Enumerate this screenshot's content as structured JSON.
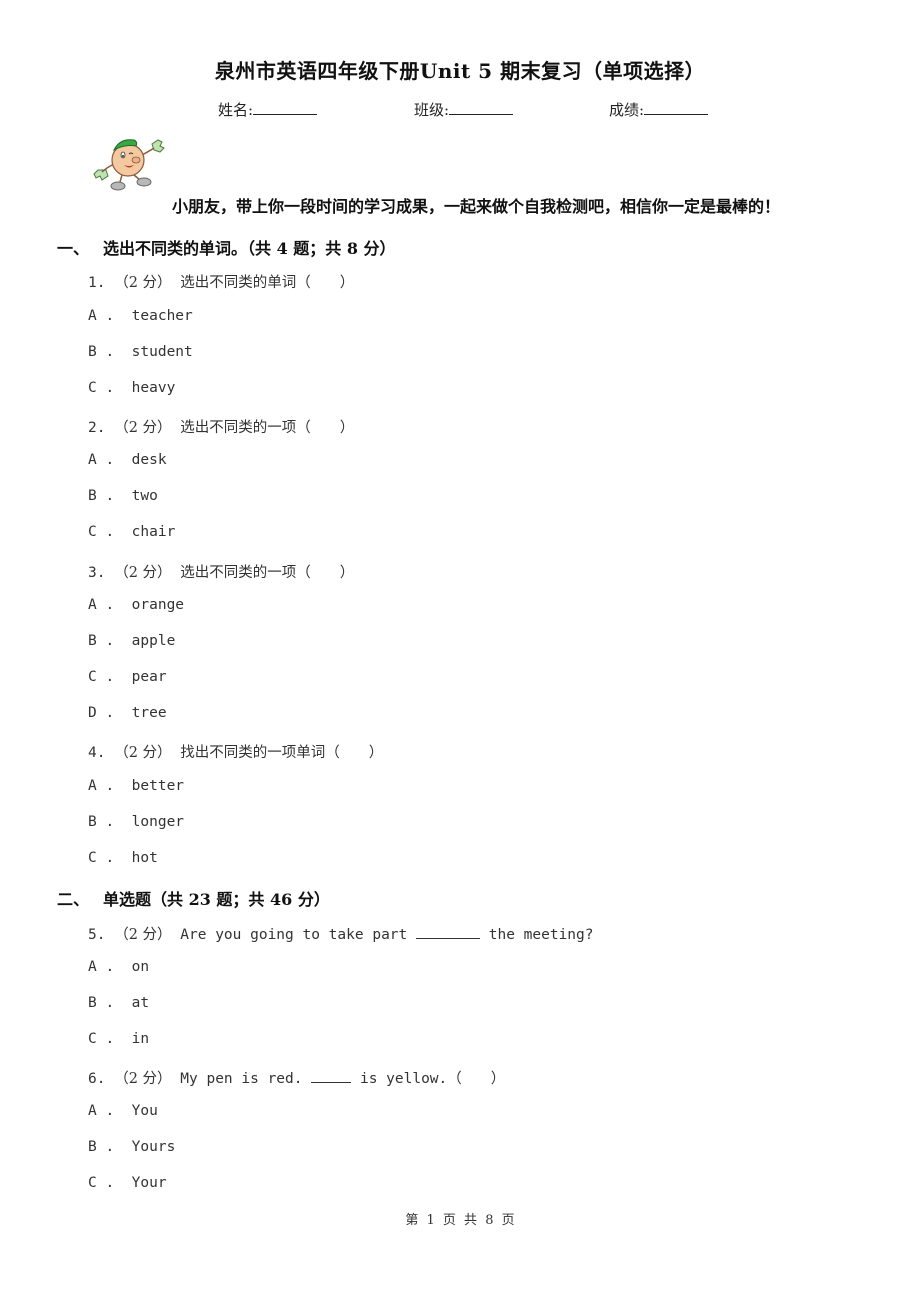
{
  "header": {
    "title": "泉州市英语四年级下册Unit 5 期末复习（单项选择）",
    "fields": [
      {
        "label": "姓名:"
      },
      {
        "label": "班级:"
      },
      {
        "label": "成绩:"
      }
    ]
  },
  "greeting": "小朋友，带上你一段时间的学习成果，一起来做个自我检测吧，相信你一定是最棒的！",
  "mascot_icon": "cartoon-mascot-icon",
  "sections": [
    {
      "number": "一、",
      "heading": "选出不同类的单词。（共 4 题；共 8 分）",
      "questions": [
        {
          "num": "1.",
          "score": "（2 分）",
          "stem": "选出不同类的单词（　　）",
          "options": [
            {
              "letter": "A",
              "text": "teacher"
            },
            {
              "letter": "B",
              "text": "student"
            },
            {
              "letter": "C",
              "text": "heavy"
            }
          ]
        },
        {
          "num": "2.",
          "score": "（2 分）",
          "stem": "选出不同类的一项（　　）",
          "options": [
            {
              "letter": "A",
              "text": "desk"
            },
            {
              "letter": "B",
              "text": "two"
            },
            {
              "letter": "C",
              "text": "chair"
            }
          ]
        },
        {
          "num": "3.",
          "score": "（2 分）",
          "stem": "选出不同类的一项（　　）",
          "options": [
            {
              "letter": "A",
              "text": "orange"
            },
            {
              "letter": "B",
              "text": "apple"
            },
            {
              "letter": "C",
              "text": "pear"
            },
            {
              "letter": "D",
              "text": "tree"
            }
          ]
        },
        {
          "num": "4.",
          "score": "（2 分）",
          "stem": "找出不同类的一项单词（　　）",
          "options": [
            {
              "letter": "A",
              "text": "better"
            },
            {
              "letter": "B",
              "text": "longer"
            },
            {
              "letter": "C",
              "text": "hot"
            }
          ]
        }
      ]
    },
    {
      "number": "二、",
      "heading": "单选题（共 23 题；共 46 分）",
      "questions": [
        {
          "num": "5.",
          "score": "（2 分）",
          "stem_before": "Are you going to take part",
          "stem_after": "the meeting?",
          "options": [
            {
              "letter": "A",
              "text": "on"
            },
            {
              "letter": "B",
              "text": "at"
            },
            {
              "letter": "C",
              "text": "in"
            }
          ]
        },
        {
          "num": "6.",
          "score": "（2 分）",
          "stem_before": "My pen is red.",
          "stem_after": "is yellow.（　　）",
          "options": [
            {
              "letter": "A",
              "text": "You"
            },
            {
              "letter": "B",
              "text": "Yours"
            },
            {
              "letter": "C",
              "text": "Your"
            }
          ]
        }
      ]
    }
  ],
  "footer": "第 1 页 共 8 页"
}
